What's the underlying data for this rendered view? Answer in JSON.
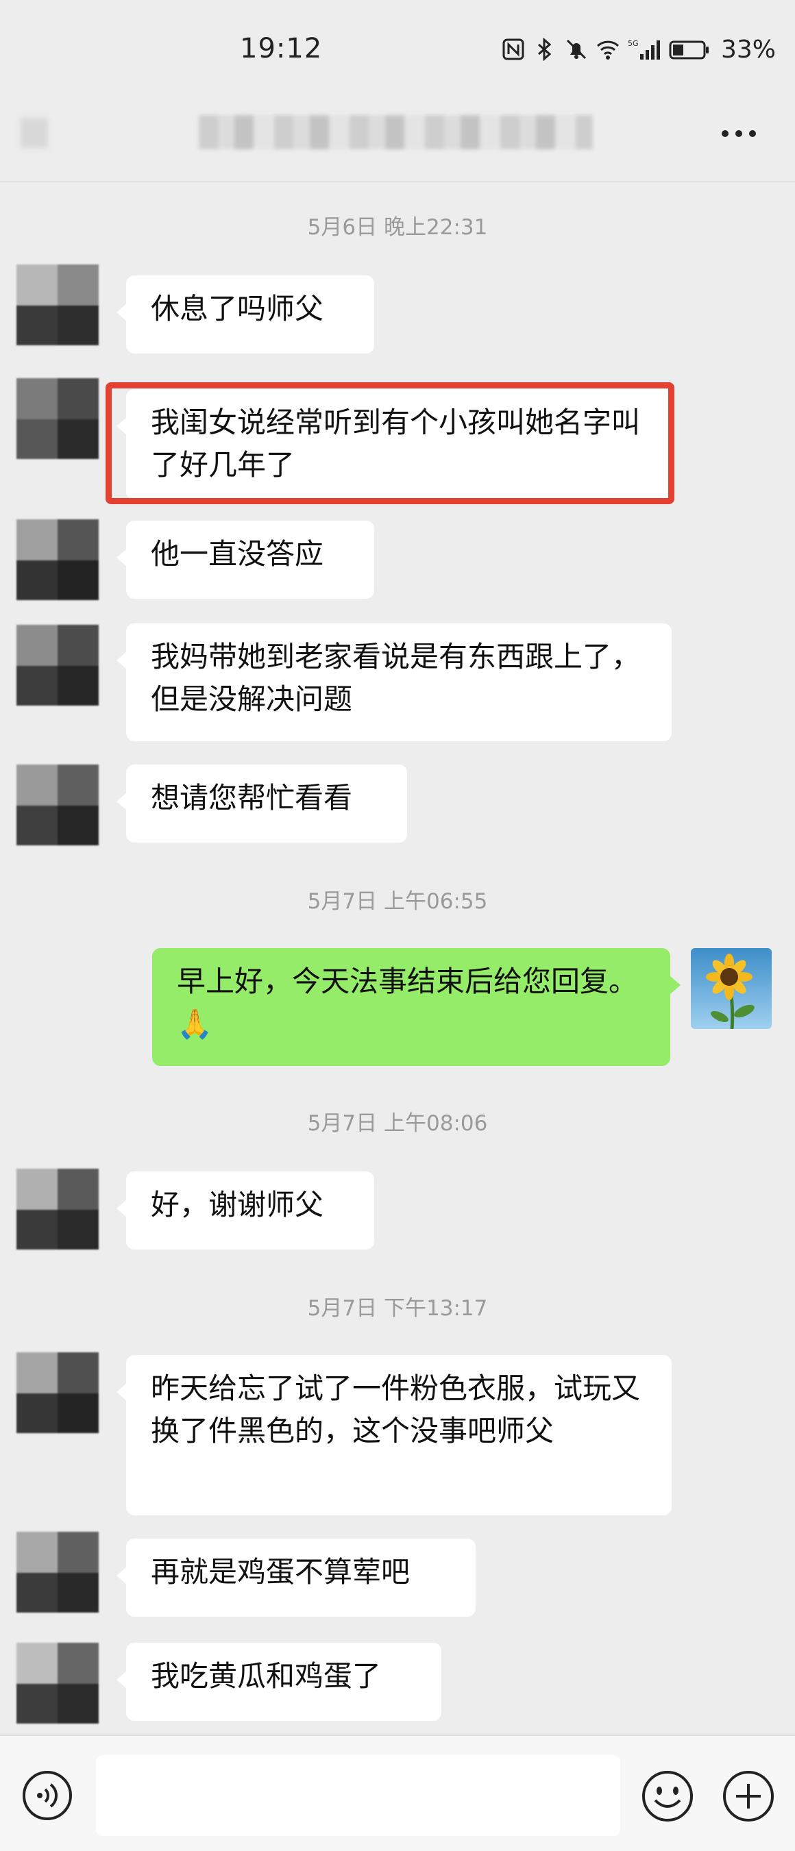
{
  "status_bar": {
    "time": "19:12",
    "network": "5G",
    "battery": "33%"
  },
  "header": {
    "title": "",
    "more_icon": "more-dots-icon"
  },
  "timestamps": [
    "5月6日 晚上22:31",
    "5月7日 上午06:55",
    "5月7日 上午08:06",
    "5月7日 下午13:17"
  ],
  "messages": [
    {
      "side": "left",
      "text": "休息了吗师父"
    },
    {
      "side": "left",
      "text": "我闺女说经常听到有个小孩叫她名字叫了好几年了",
      "highlighted": true
    },
    {
      "side": "left",
      "text": "他一直没答应"
    },
    {
      "side": "left",
      "text": "我妈带她到老家看说是有东西跟上了，但是没解决问题"
    },
    {
      "side": "left",
      "text": "想请您帮忙看看"
    },
    {
      "side": "right",
      "text": "早上好，今天法事结束后给您回复。🙏"
    },
    {
      "side": "left",
      "text": "好，谢谢师父"
    },
    {
      "side": "left",
      "text": "昨天给忘了试了一件粉色衣服，试玩又换了件黑色的，这个没事吧师父"
    },
    {
      "side": "left",
      "text": "再就是鸡蛋不算荤吧"
    },
    {
      "side": "left",
      "text": "我吃黄瓜和鸡蛋了"
    }
  ],
  "input_bar": {
    "voice_icon": "voice-icon",
    "input_value": "",
    "emoji_icon": "emoji-icon",
    "plus_icon": "plus-icon"
  },
  "colors": {
    "background": "#ededed",
    "incoming_bubble": "#ffffff",
    "outgoing_bubble": "#95ec69",
    "highlight": "#e34132",
    "timestamp": "#9a9a9a"
  }
}
